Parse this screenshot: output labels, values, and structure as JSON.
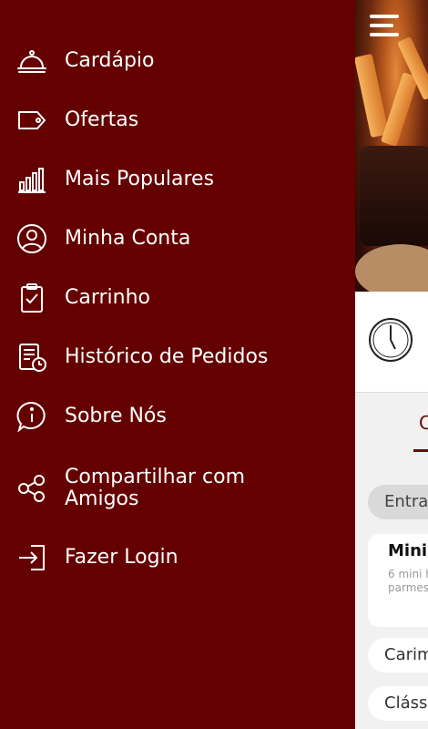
{
  "menu": {
    "items": [
      {
        "label": "Cardápio",
        "icon": "cloche-icon"
      },
      {
        "label": "Ofertas",
        "icon": "tag-icon"
      },
      {
        "label": "Mais Populares",
        "icon": "bar-chart-icon"
      },
      {
        "label": "Minha Conta",
        "icon": "user-circle-icon"
      },
      {
        "label": "Carrinho",
        "icon": "clipboard-check-icon"
      },
      {
        "label": "Histórico de Pedidos",
        "icon": "receipt-clock-icon"
      },
      {
        "label": "Sobre Nós",
        "icon": "info-bubble-icon"
      },
      {
        "label": "Compartilhar com\nAmigos",
        "icon": "share-icon"
      },
      {
        "label": "Fazer Login",
        "icon": "login-icon"
      }
    ]
  },
  "background": {
    "tab_letter": "C",
    "chip_label": "Entra",
    "product": {
      "title": "Mini",
      "desc_line1": "6 mini h",
      "desc_line2": "parmes"
    },
    "category_1": "Carim",
    "category_2": "Cláss"
  },
  "colors": {
    "drawer": "#650000",
    "accent": "#6a0a0a"
  }
}
